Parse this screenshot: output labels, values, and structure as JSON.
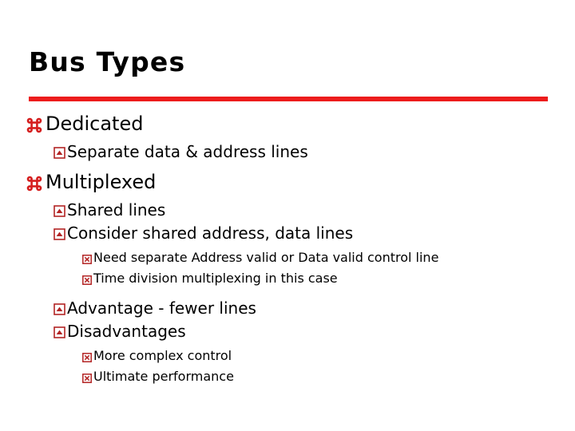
{
  "slide": {
    "title": "Bus Types",
    "accent_color": "#ED1C1C",
    "bullet_color_l1": "#D51F1F",
    "bullet_color_l2": "#B32424",
    "bullet_color_l3": "#B32424",
    "text_color": "#000000",
    "background_color": "#FFFFFF"
  },
  "bullets": {
    "l1_dedicated": "Dedicated",
    "l2_separate": "Separate data & address lines",
    "l1_multiplexed": "Multiplexed",
    "l2_shared": "Shared lines",
    "l2_consider": "Consider shared address, data lines",
    "l3_need": "Need separate Address valid or Data valid control line",
    "l3_time": "Time division multiplexing in this case",
    "l2_advantage": "Advantage - fewer lines",
    "l2_disadvantages": "Disadvantages",
    "l3_more": "More complex control",
    "l3_ultimate": "Ultimate performance"
  },
  "icons": {
    "l1_bullet": "place-of-interest-bullet-icon",
    "l2_bullet": "boxed-chevron-bullet-icon",
    "l3_bullet": "boxed-x-bullet-icon"
  }
}
